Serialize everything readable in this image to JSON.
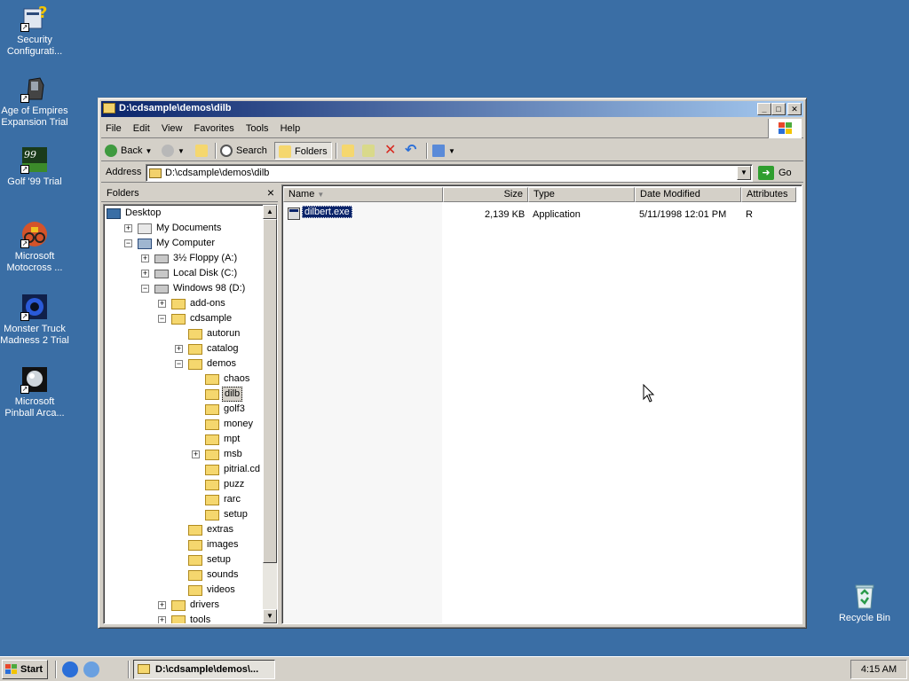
{
  "desktop": {
    "icons": [
      {
        "label": "Security Configurati...",
        "icon": "security-config-icon"
      },
      {
        "label": "Age of Empires Expansion Trial",
        "icon": "age-of-empires-icon"
      },
      {
        "label": "Golf '99 Trial",
        "icon": "golf-99-icon"
      },
      {
        "label": "Microsoft Motocross ...",
        "icon": "motocross-icon"
      },
      {
        "label": "Monster Truck Madness 2 Trial",
        "icon": "monster-truck-icon"
      },
      {
        "label": "Microsoft Pinball Arca...",
        "icon": "pinball-icon"
      }
    ],
    "recycle_bin": {
      "label": "Recycle Bin",
      "icon": "recycle-bin-icon"
    }
  },
  "window": {
    "title": "D:\\cdsample\\demos\\dilb",
    "menu": [
      "File",
      "Edit",
      "View",
      "Favorites",
      "Tools",
      "Help"
    ],
    "toolbar": {
      "back": "Back",
      "search": "Search",
      "folders": "Folders"
    },
    "address": {
      "label": "Address",
      "value": "D:\\cdsample\\demos\\dilb",
      "go": "Go"
    },
    "folders_pane": {
      "title": "Folders",
      "tree": [
        {
          "label": "Desktop",
          "expander": "",
          "icon": "desktop"
        },
        {
          "label": "My Documents",
          "expander": "+",
          "icon": "docs"
        },
        {
          "label": "My Computer",
          "expander": "−",
          "icon": "comp"
        },
        {
          "label": "3½ Floppy (A:)",
          "expander": "+",
          "icon": "drive"
        },
        {
          "label": "Local Disk (C:)",
          "expander": "+",
          "icon": "drive"
        },
        {
          "label": "Windows 98 (D:)",
          "expander": "−",
          "icon": "drive"
        },
        {
          "label": "add-ons",
          "expander": "+",
          "icon": "folder"
        },
        {
          "label": "cdsample",
          "expander": "−",
          "icon": "folder"
        },
        {
          "label": "autorun",
          "expander": "",
          "icon": "folder"
        },
        {
          "label": "catalog",
          "expander": "+",
          "icon": "folder"
        },
        {
          "label": "demos",
          "expander": "−",
          "icon": "folder"
        },
        {
          "label": "chaos",
          "expander": "",
          "icon": "folder"
        },
        {
          "label": "dilb",
          "expander": "",
          "icon": "folder",
          "selected": true
        },
        {
          "label": "golf3",
          "expander": "",
          "icon": "folder"
        },
        {
          "label": "money",
          "expander": "",
          "icon": "folder"
        },
        {
          "label": "mpt",
          "expander": "",
          "icon": "folder"
        },
        {
          "label": "msb",
          "expander": "+",
          "icon": "folder"
        },
        {
          "label": "pitrial.cd",
          "expander": "",
          "icon": "folder"
        },
        {
          "label": "puzz",
          "expander": "",
          "icon": "folder"
        },
        {
          "label": "rarc",
          "expander": "",
          "icon": "folder"
        },
        {
          "label": "setup",
          "expander": "",
          "icon": "folder"
        },
        {
          "label": "extras",
          "expander": "",
          "icon": "folder"
        },
        {
          "label": "images",
          "expander": "",
          "icon": "folder"
        },
        {
          "label": "setup",
          "expander": "",
          "icon": "folder"
        },
        {
          "label": "sounds",
          "expander": "",
          "icon": "folder"
        },
        {
          "label": "videos",
          "expander": "",
          "icon": "folder"
        },
        {
          "label": "drivers",
          "expander": "+",
          "icon": "folder"
        },
        {
          "label": "tools",
          "expander": "+",
          "icon": "folder"
        }
      ]
    },
    "file_list": {
      "columns": [
        "Name",
        "Size",
        "Type",
        "Date Modified",
        "Attributes"
      ],
      "rows": [
        {
          "name": "dilbert.exe",
          "size": "2,139 KB",
          "type": "Application",
          "date": "5/11/1998 12:01 PM",
          "attributes": "R"
        }
      ]
    }
  },
  "taskbar": {
    "start": "Start",
    "task": "D:\\cdsample\\demos\\...",
    "clock": "4:15 AM"
  }
}
